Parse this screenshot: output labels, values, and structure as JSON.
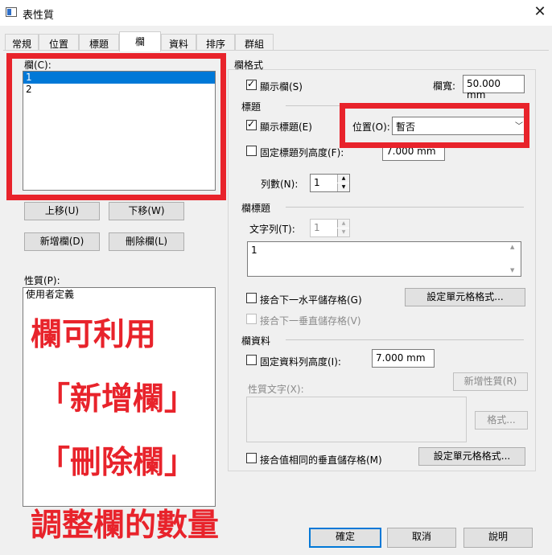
{
  "window": {
    "title": "表性質",
    "close_glyph": "✕"
  },
  "tabs": [
    "常規",
    "位置",
    "標題",
    "欄",
    "資料",
    "排序",
    "群組"
  ],
  "left": {
    "columns_label": "欄(C):",
    "columns_items": [
      "1",
      "2"
    ],
    "move_up": "上移(U)",
    "move_down": "下移(W)",
    "add_column": "新增欄(D)",
    "delete_column": "刪除欄(L)",
    "properties_label": "性質(P):",
    "properties_items": [
      "使用者定義"
    ]
  },
  "annotation": {
    "line1": "欄可利用",
    "line2": "「新增欄」",
    "line3": "「刪除欄」",
    "line4": "調整欄的數量"
  },
  "right": {
    "column_format": {
      "title": "欄格式",
      "show_column": "顯示欄(S)",
      "width_label": "欄寬:",
      "width_value": "50.000 mm"
    },
    "title_section": {
      "title": "標題",
      "show_title": "顯示標題(E)",
      "position_label": "位置(O):",
      "position_value": "暫否",
      "fixed_height": "固定標題列高度(F):",
      "fixed_height_value": "7.000 mm",
      "rows_label": "列數(N):",
      "rows_value": "1"
    },
    "column_title": {
      "title": "欄標題",
      "text_row_label": "文字列(T):",
      "text_row_value": "1",
      "text_value": "1",
      "merge_h": "接合下一水平儲存格(G)",
      "merge_v": "接合下一垂直儲存格(V)",
      "cell_format_btn": "設定單元格格式..."
    },
    "column_data": {
      "title": "欄資料",
      "fixed_height": "固定資料列高度(I):",
      "fixed_height_value": "7.000 mm",
      "prop_text_label": "性質文字(X):",
      "add_prop_btn": "新增性質(R)",
      "format_btn": "格式...",
      "merge_same": "接合值相同的垂直儲存格(M)",
      "cell_format_btn": "設定單元格格式..."
    }
  },
  "footer": {
    "ok": "確定",
    "cancel": "取消",
    "help": "說明"
  }
}
